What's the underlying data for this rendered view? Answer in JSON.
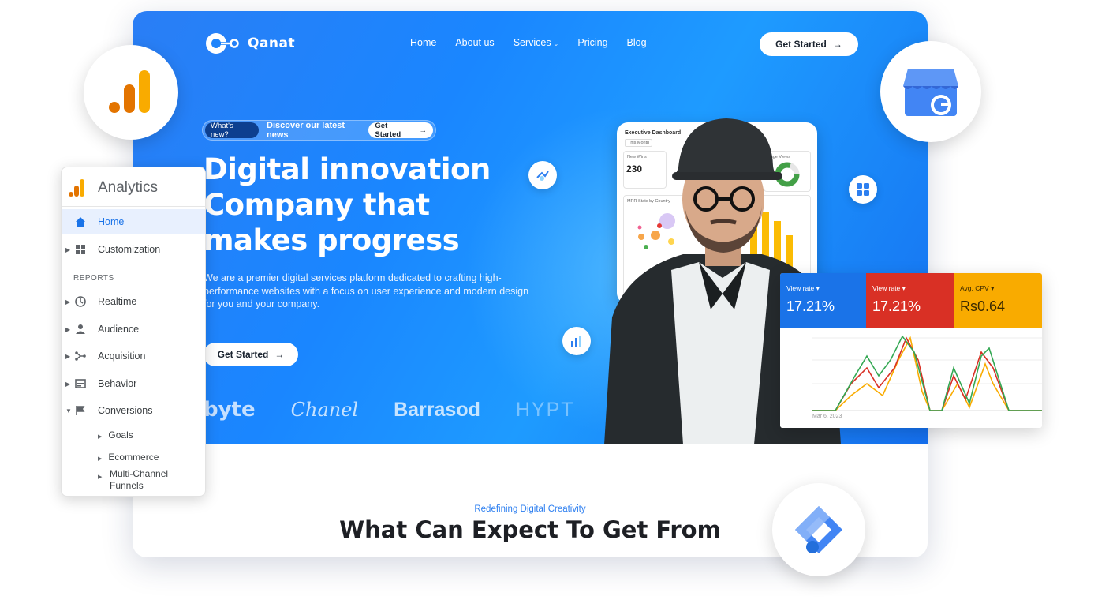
{
  "site": {
    "brand": "Qanat",
    "nav": [
      "Home",
      "About us",
      "Services",
      "Pricing",
      "Blog"
    ],
    "top_cta": "Get Started",
    "pill": {
      "badge": "What's new?",
      "text": "Discover our latest news",
      "button": "Get Started"
    },
    "headline": "Digital innovation Company that makes progress",
    "description": "We are a premier digital services platform dedicated to crafting high-performance websites with a focus on user experience and modern design for you and your company.",
    "hero_cta": "Get Started",
    "brands": [
      "byte",
      "Chanel",
      "Barrasod",
      "HYPT"
    ],
    "section_tag": "Redefining Digital Creativity",
    "section_heading": "What Can Expect To Get From"
  },
  "dashboard": {
    "title": "Executive Dashboard",
    "filter": "This Month",
    "new_wins_label": "New Wins",
    "new_wins_value": "230",
    "page_views_label": "Page Views",
    "chart_label": "MRR Stats by Country"
  },
  "analytics": {
    "title": "Analytics",
    "home": "Home",
    "customization": "Customization",
    "section": "REPORTS",
    "items": [
      "Realtime",
      "Audience",
      "Acquisition",
      "Behavior",
      "Conversions"
    ],
    "sub_items": [
      "Goals",
      "Ecommerce",
      "Multi-Channel Funnels"
    ]
  },
  "stats": {
    "cards": [
      {
        "label": "View rate",
        "value": "17.21%",
        "color": "#1a73e8"
      },
      {
        "label": "View rate",
        "value": "17.21%",
        "color": "#d93025"
      },
      {
        "label": "Avg. CPV",
        "value": "Rs0.64",
        "color": "#f9ab00"
      }
    ],
    "date": "Mar 6, 2023"
  },
  "colors": {
    "hero": "#1a86ff",
    "accent": "#2d7ff0"
  }
}
